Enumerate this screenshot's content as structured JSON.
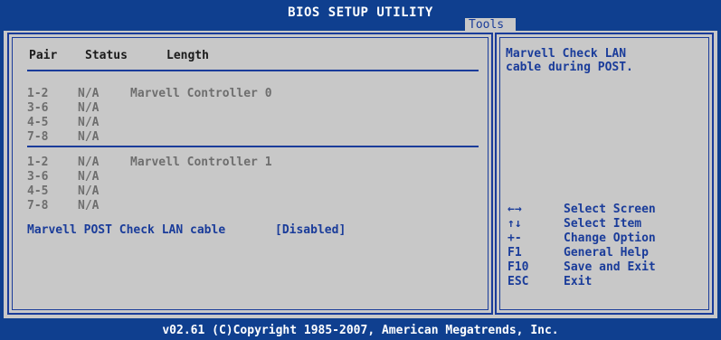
{
  "header": {
    "title": "BIOS SETUP UTILITY",
    "active_tab": "Tools"
  },
  "main": {
    "columns": [
      "Pair",
      "Status",
      "Length"
    ],
    "controllers": [
      {
        "rows": [
          {
            "pair": "1-2",
            "status": "N/A",
            "length": "Marvell Controller 0"
          },
          {
            "pair": "3-6",
            "status": "N/A",
            "length": ""
          },
          {
            "pair": "4-5",
            "status": "N/A",
            "length": ""
          },
          {
            "pair": "7-8",
            "status": "N/A",
            "length": ""
          }
        ]
      },
      {
        "rows": [
          {
            "pair": "1-2",
            "status": "N/A",
            "length": "Marvell Controller 1"
          },
          {
            "pair": "3-6",
            "status": "N/A",
            "length": ""
          },
          {
            "pair": "4-5",
            "status": "N/A",
            "length": ""
          },
          {
            "pair": "7-8",
            "status": "N/A",
            "length": ""
          }
        ]
      }
    ],
    "option": {
      "label": "Marvell POST Check LAN cable",
      "value": "[Disabled]"
    }
  },
  "help": {
    "line1": "Marvell Check LAN",
    "line2": "cable during POST."
  },
  "keys": [
    {
      "key": "←→",
      "action": "Select Screen",
      "icon": "left-right-arrows-icon"
    },
    {
      "key": "↑↓",
      "action": "Select Item",
      "icon": "up-down-arrows-icon"
    },
    {
      "key": "+-",
      "action": "Change Option",
      "icon": ""
    },
    {
      "key": "F1",
      "action": "General Help",
      "icon": ""
    },
    {
      "key": "F10",
      "action": "Save and Exit",
      "icon": ""
    },
    {
      "key": "ESC",
      "action": "Exit",
      "icon": ""
    }
  ],
  "footer": {
    "copyright": "v02.61 (C)Copyright 1985-2007, American Megatrends, Inc."
  },
  "colors": {
    "background": "#0f3f8f",
    "panel": "#c8c8c8",
    "accent": "#1a3c9a",
    "dim_text": "#6e6e6e"
  }
}
